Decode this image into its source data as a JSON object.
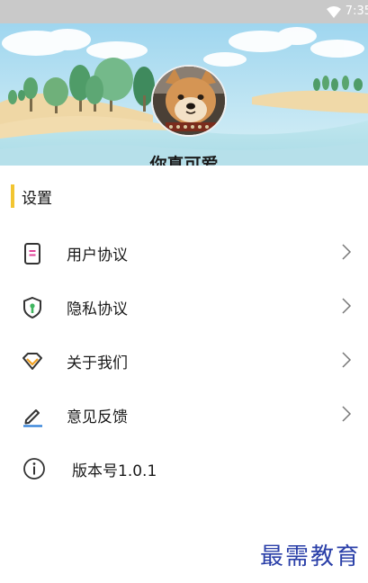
{
  "status_bar": {
    "time": "7:35",
    "wifi_icon": "wifi-icon"
  },
  "profile": {
    "name": "你真可爱",
    "avatar": "shiba-dog-avatar"
  },
  "settings": {
    "section_title": "设置",
    "accent_color": "#f2c531",
    "items": [
      {
        "label": "用户协议",
        "icon": "document-icon"
      },
      {
        "label": "隐私协议",
        "icon": "shield-icon"
      },
      {
        "label": "关于我们",
        "icon": "diamond-icon"
      },
      {
        "label": "意见反馈",
        "icon": "edit-icon"
      }
    ],
    "version_label": "版本号1.0.1",
    "version_icon": "info-icon"
  },
  "watermark": "最需教育"
}
